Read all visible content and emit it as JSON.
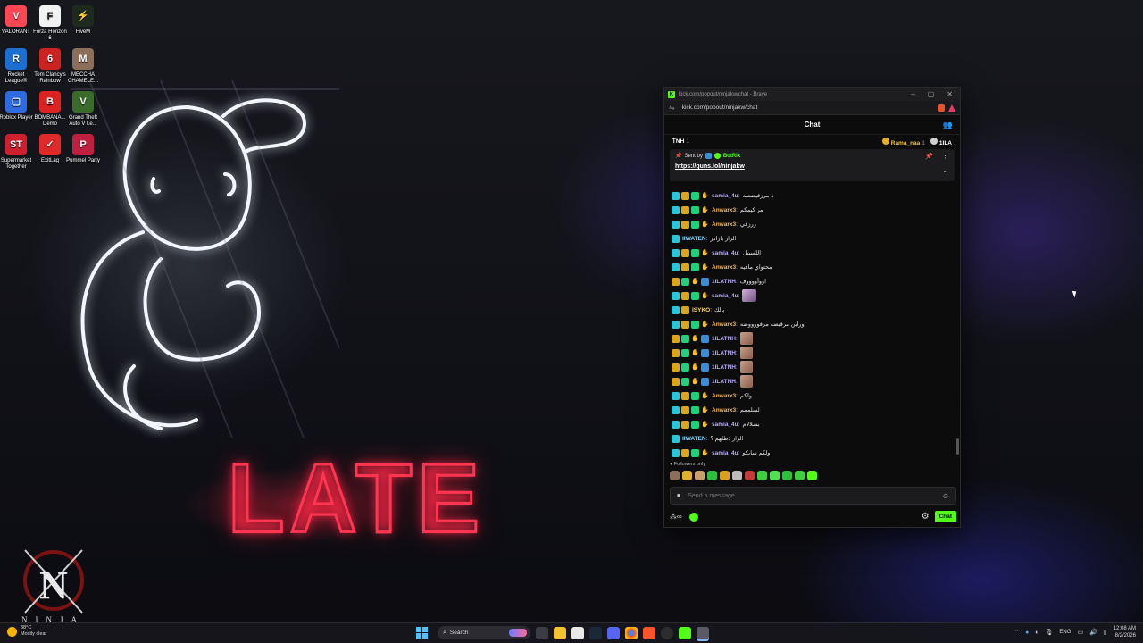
{
  "desktop_icons": [
    {
      "label": "VALORANT",
      "color": "#ff4655",
      "glyph": "V"
    },
    {
      "label": "Forza Horizon 6",
      "color": "#f2f2f2",
      "glyph": "F"
    },
    {
      "label": "FiveM",
      "color": "#1f2a1f",
      "glyph": "⚡"
    },
    {
      "label": "Rocket League®",
      "color": "#1b6fd0",
      "glyph": "R"
    },
    {
      "label": "Tom Clancy's Rainbow",
      "color": "#c22",
      "glyph": "6"
    },
    {
      "label": "MECCHA CHAMELE...",
      "color": "#8a6f5a",
      "glyph": "M"
    },
    {
      "label": "Roblox Player",
      "color": "#2f6be0",
      "glyph": "▢"
    },
    {
      "label": "BOMBANA... Demo",
      "color": "#d22",
      "glyph": "B"
    },
    {
      "label": "Grand Theft Auto V Le...",
      "color": "#3a6b2a",
      "glyph": "V"
    },
    {
      "label": "Supermarket Together",
      "color": "#d02030",
      "glyph": "ST"
    },
    {
      "label": "ExitLag",
      "color": "#e02a2a",
      "glyph": "✓"
    },
    {
      "label": "Pummel Party",
      "color": "#c02040",
      "glyph": "P"
    }
  ],
  "logo_text": "NINJA",
  "browser": {
    "title": "kick.com/popout/ninjakw/chat - Brave",
    "url": "kick.com/popout/ninjakw/chat"
  },
  "chat": {
    "header": "Chat",
    "leaderboard": {
      "left_name": "ᎢNH",
      "left_count": "1",
      "right": [
        {
          "name": "Rama_naa",
          "count": "1"
        },
        {
          "name": "1ILA",
          "count": ""
        }
      ]
    },
    "pinned": {
      "sent_by": "Sent by",
      "sender": "BotRix",
      "link": "https://guns.lol/ninjakw"
    },
    "messages": [
      {
        "user": "samia_4u",
        "color": "c-purple",
        "badges": [
          "teal",
          "gold",
          "green",
          "hand"
        ],
        "text": "ة مرزقيضضه"
      },
      {
        "user": "Anwarx3",
        "color": "c-orange",
        "badges": [
          "teal",
          "gold",
          "green",
          "hand"
        ],
        "text": "مر كيمكم"
      },
      {
        "user": "Anwarx3",
        "color": "c-orange",
        "badges": [
          "teal",
          "gold",
          "green",
          "hand"
        ],
        "text": "ررزفي"
      },
      {
        "user": "IIWATEN",
        "color": "c-cyan",
        "badges": [
          "teal"
        ],
        "text": "الراز بارادر"
      },
      {
        "user": "samia_4u",
        "color": "c-purple",
        "badges": [
          "teal",
          "gold",
          "green",
          "hand"
        ],
        "text": "اللسبيل"
      },
      {
        "user": "Anwarx3",
        "color": "c-orange",
        "badges": [
          "teal",
          "gold",
          "green",
          "hand"
        ],
        "text": "محتواي مافيه"
      },
      {
        "user": "1ILATNH",
        "color": "c-purple",
        "badges": [
          "gold",
          "green",
          "hand",
          "blue"
        ],
        "text": "اووأووووف"
      },
      {
        "user": "samia_4u",
        "color": "c-purple",
        "badges": [
          "teal",
          "gold",
          "green",
          "hand"
        ],
        "text": "",
        "emote": "emote2"
      },
      {
        "user": "ISYKO",
        "color": "c-yellow",
        "badges": [
          "teal",
          "gold"
        ],
        "text": "بالك"
      },
      {
        "user": "Anwarx3",
        "color": "c-orange",
        "badges": [
          "teal",
          "gold",
          "green",
          "hand"
        ],
        "text": "وراين مرقيضه مرفووووضه"
      },
      {
        "user": "1ILATNH",
        "color": "c-purple",
        "badges": [
          "gold",
          "green",
          "hand",
          "blue"
        ],
        "text": "",
        "emote": "emote"
      },
      {
        "user": "1ILATNH",
        "color": "c-purple",
        "badges": [
          "gold",
          "green",
          "hand",
          "blue"
        ],
        "text": "",
        "emote": "emote"
      },
      {
        "user": "1ILATNH",
        "color": "c-purple",
        "badges": [
          "gold",
          "green",
          "hand",
          "blue"
        ],
        "text": "",
        "emote": "emote"
      },
      {
        "user": "1ILATNH",
        "color": "c-purple",
        "badges": [
          "gold",
          "green",
          "hand",
          "blue"
        ],
        "text": "",
        "emote": "emote"
      },
      {
        "user": "Anwarx3",
        "color": "c-orange",
        "badges": [
          "teal",
          "gold",
          "green",
          "hand"
        ],
        "text": "ولكم"
      },
      {
        "user": "Anwarx3",
        "color": "c-orange",
        "badges": [
          "teal",
          "gold",
          "green",
          "hand"
        ],
        "text": "لسلممم"
      },
      {
        "user": "samia_4u",
        "color": "c-purple",
        "badges": [
          "teal",
          "gold",
          "green",
          "hand"
        ],
        "text": "بسلالام"
      },
      {
        "user": "IIWATEN",
        "color": "c-cyan",
        "badges": [
          "teal"
        ],
        "text": "الراز ذظلهم ؟"
      },
      {
        "user": "samia_4u",
        "color": "c-purple",
        "badges": [
          "teal",
          "gold",
          "green",
          "hand"
        ],
        "text": "ولكم سايكو"
      }
    ],
    "followers_only": "Followers only",
    "input_placeholder": "Send a message",
    "send_label": "Chat"
  },
  "taskbar": {
    "temperature": "38°C",
    "weather": "Mostly clear",
    "search_label": "Search",
    "language": "ENG",
    "time": "12:08 AM",
    "date": "8/2/2026"
  }
}
